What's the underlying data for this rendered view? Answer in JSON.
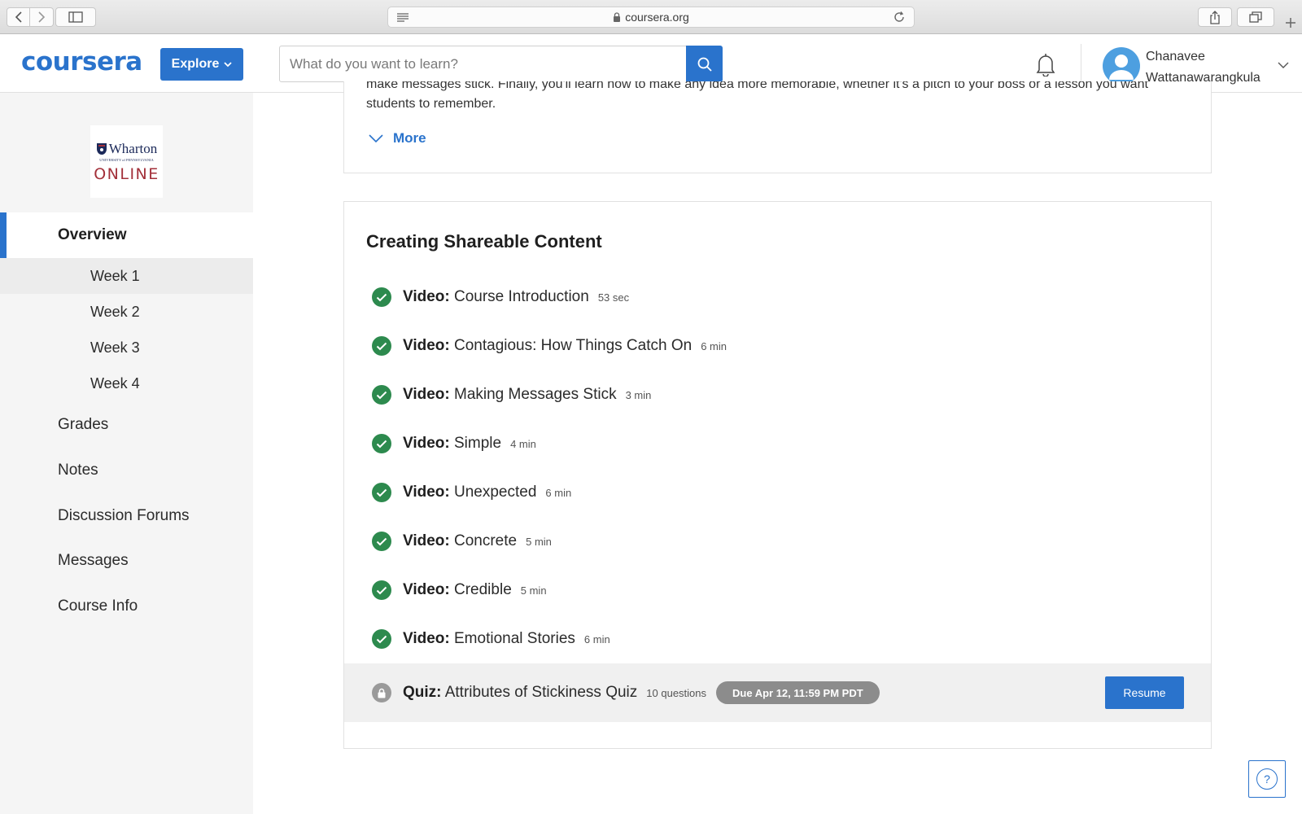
{
  "browser": {
    "url": "coursera.org",
    "icons": [
      "back-icon",
      "forward-icon",
      "sidebar-toggle-icon",
      "reader-icon",
      "lock-icon",
      "reload-icon",
      "share-icon",
      "tabs-icon",
      "new-tab-icon"
    ]
  },
  "header": {
    "logo": "coursera",
    "explore_label": "Explore",
    "search_placeholder": "What do you want to learn?",
    "user_first": "Chanavee",
    "user_last": "Wattanawarangkula",
    "accent_color": "#2a73cc"
  },
  "sidebar": {
    "partner": {
      "name": "Wharton",
      "subtitle": "UNIVERSITY of PENNSYLVANIA",
      "online": "ONLINE"
    },
    "items": [
      {
        "label": "Overview",
        "active": true
      },
      {
        "label": "Week 1",
        "sub": true,
        "current": true
      },
      {
        "label": "Week 2",
        "sub": true
      },
      {
        "label": "Week 3",
        "sub": true
      },
      {
        "label": "Week 4",
        "sub": true
      },
      {
        "label": "Grades"
      },
      {
        "label": "Notes"
      },
      {
        "label": "Discussion Forums"
      },
      {
        "label": "Messages"
      },
      {
        "label": "Course Info"
      }
    ]
  },
  "main": {
    "description_line1": "make messages stick. Finally, you'll learn how to make any idea more memorable, whether it's a pitch to your boss or a lesson you want",
    "description_line2": "students to remember.",
    "more_label": "More",
    "lesson": {
      "title": "Creating Shareable Content",
      "videos": [
        {
          "type": "Video:",
          "title": "Course Introduction",
          "duration": "53 sec"
        },
        {
          "type": "Video:",
          "title": "Contagious: How Things Catch On",
          "duration": "6 min"
        },
        {
          "type": "Video:",
          "title": "Making Messages Stick",
          "duration": "3 min"
        },
        {
          "type": "Video:",
          "title": "Simple",
          "duration": "4 min"
        },
        {
          "type": "Video:",
          "title": "Unexpected",
          "duration": "6 min"
        },
        {
          "type": "Video:",
          "title": "Concrete",
          "duration": "5 min"
        },
        {
          "type": "Video:",
          "title": "Credible",
          "duration": "5 min"
        },
        {
          "type": "Video:",
          "title": "Emotional Stories",
          "duration": "6 min"
        }
      ],
      "quiz": {
        "type": "Quiz:",
        "title": "Attributes of Stickiness Quiz",
        "questions": "10 questions",
        "due": "Due Apr 12, 11:59 PM PDT",
        "action": "Resume"
      }
    },
    "completed_color": "#2d8a4e",
    "help_label": "?"
  }
}
